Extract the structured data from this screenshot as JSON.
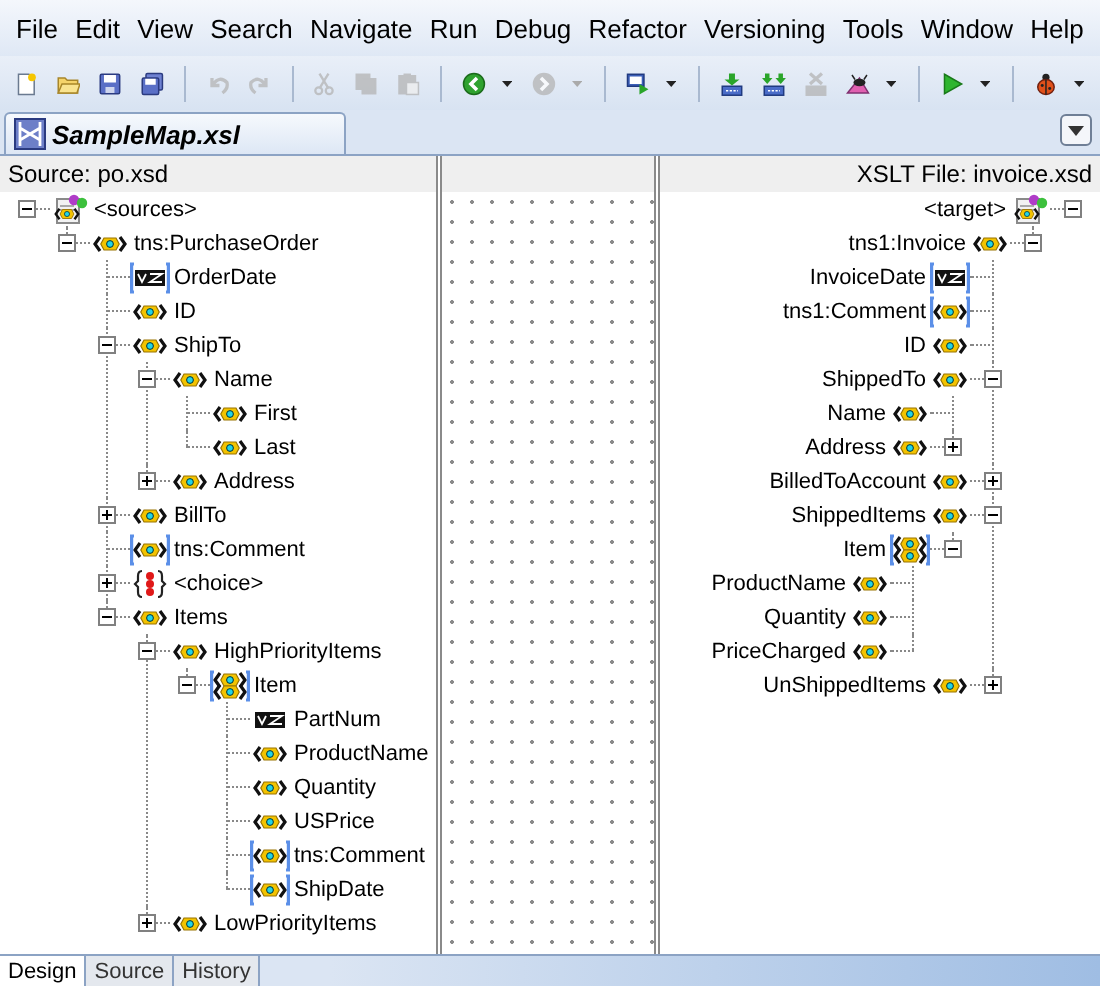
{
  "menu": [
    "File",
    "Edit",
    "View",
    "Search",
    "Navigate",
    "Run",
    "Debug",
    "Refactor",
    "Versioning",
    "Tools",
    "Window",
    "Help"
  ],
  "toolbar": [
    {
      "kind": "new",
      "disabled": false,
      "dropdown": false
    },
    {
      "kind": "open",
      "disabled": false,
      "dropdown": false
    },
    {
      "kind": "save",
      "disabled": false,
      "dropdown": false
    },
    {
      "kind": "save-all",
      "disabled": false,
      "dropdown": false
    },
    {
      "kind": "separator"
    },
    {
      "kind": "undo",
      "disabled": true,
      "dropdown": false
    },
    {
      "kind": "redo",
      "disabled": true,
      "dropdown": false
    },
    {
      "kind": "separator"
    },
    {
      "kind": "cut",
      "disabled": true,
      "dropdown": false
    },
    {
      "kind": "copy",
      "disabled": true,
      "dropdown": false
    },
    {
      "kind": "paste",
      "disabled": true,
      "dropdown": false
    },
    {
      "kind": "separator"
    },
    {
      "kind": "back",
      "disabled": false,
      "dropdown": true
    },
    {
      "kind": "forward",
      "disabled": true,
      "dropdown": true
    },
    {
      "kind": "separator"
    },
    {
      "kind": "sql",
      "disabled": false,
      "dropdown": true
    },
    {
      "kind": "separator"
    },
    {
      "kind": "deploy",
      "disabled": false,
      "dropdown": false
    },
    {
      "kind": "deploy-all",
      "disabled": false,
      "dropdown": false
    },
    {
      "kind": "undeploy",
      "disabled": true,
      "dropdown": false
    },
    {
      "kind": "profile",
      "disabled": false,
      "dropdown": true
    },
    {
      "kind": "separator"
    },
    {
      "kind": "run",
      "disabled": false,
      "dropdown": true
    },
    {
      "kind": "separator"
    },
    {
      "kind": "debug",
      "disabled": false,
      "dropdown": true
    }
  ],
  "editor_tab": {
    "title": "SampleMap.xsl"
  },
  "source": {
    "header": "Source: po.xsd",
    "tree": [
      {
        "label": "<sources>",
        "kind": "root",
        "optional": false,
        "expanded": true,
        "children": [
          {
            "label": "tns:PurchaseOrder",
            "kind": "element",
            "optional": false,
            "expanded": true,
            "children": [
              {
                "label": "OrderDate",
                "kind": "attribute",
                "optional": true
              },
              {
                "label": "ID",
                "kind": "element",
                "optional": false
              },
              {
                "label": "ShipTo",
                "kind": "element",
                "optional": false,
                "expanded": true,
                "children": [
                  {
                    "label": "Name",
                    "kind": "element",
                    "optional": false,
                    "expanded": true,
                    "children": [
                      {
                        "label": "First",
                        "kind": "element",
                        "optional": false
                      },
                      {
                        "label": "Last",
                        "kind": "element",
                        "optional": false
                      }
                    ]
                  },
                  {
                    "label": "Address",
                    "kind": "element",
                    "optional": false,
                    "expanded": false
                  }
                ]
              },
              {
                "label": "BillTo",
                "kind": "element",
                "optional": false,
                "expanded": false
              },
              {
                "label": "tns:Comment",
                "kind": "element",
                "optional": true
              },
              {
                "label": "<choice>",
                "kind": "choice",
                "optional": false,
                "expanded": false
              },
              {
                "label": "Items",
                "kind": "element",
                "optional": false,
                "expanded": true,
                "children": [
                  {
                    "label": "HighPriorityItems",
                    "kind": "element",
                    "optional": false,
                    "expanded": true,
                    "children": [
                      {
                        "label": "Item",
                        "kind": "repeating",
                        "optional": true,
                        "expanded": true,
                        "children": [
                          {
                            "label": "PartNum",
                            "kind": "attribute",
                            "optional": false
                          },
                          {
                            "label": "ProductName",
                            "kind": "element",
                            "optional": false
                          },
                          {
                            "label": "Quantity",
                            "kind": "element",
                            "optional": false
                          },
                          {
                            "label": "USPrice",
                            "kind": "element",
                            "optional": false
                          },
                          {
                            "label": "tns:Comment",
                            "kind": "element",
                            "optional": true
                          },
                          {
                            "label": "ShipDate",
                            "kind": "element",
                            "optional": true
                          }
                        ]
                      }
                    ]
                  },
                  {
                    "label": "LowPriorityItems",
                    "kind": "element",
                    "optional": false,
                    "expanded": false
                  }
                ]
              }
            ]
          }
        ]
      }
    ]
  },
  "target": {
    "header": "XSLT File: invoice.xsd",
    "tree": [
      {
        "label": "<target>",
        "kind": "root",
        "optional": false,
        "expanded": true,
        "children": [
          {
            "label": "tns1:Invoice",
            "kind": "element",
            "optional": false,
            "expanded": true,
            "children": [
              {
                "label": "InvoiceDate",
                "kind": "attribute",
                "optional": true
              },
              {
                "label": "tns1:Comment",
                "kind": "element",
                "optional": true
              },
              {
                "label": "ID",
                "kind": "element",
                "optional": false
              },
              {
                "label": "ShippedTo",
                "kind": "element",
                "optional": false,
                "expanded": true,
                "children": [
                  {
                    "label": "Name",
                    "kind": "element",
                    "optional": false
                  },
                  {
                    "label": "Address",
                    "kind": "element",
                    "optional": false,
                    "expanded": false
                  }
                ]
              },
              {
                "label": "BilledToAccount",
                "kind": "element",
                "optional": false,
                "expanded": false
              },
              {
                "label": "ShippedItems",
                "kind": "element",
                "optional": false,
                "expanded": true,
                "children": [
                  {
                    "label": "Item",
                    "kind": "repeating",
                    "optional": true,
                    "expanded": true,
                    "children": [
                      {
                        "label": "ProductName",
                        "kind": "element",
                        "optional": false
                      },
                      {
                        "label": "Quantity",
                        "kind": "element",
                        "optional": false
                      },
                      {
                        "label": "PriceCharged",
                        "kind": "element",
                        "optional": false
                      }
                    ]
                  }
                ]
              },
              {
                "label": "UnShippedItems",
                "kind": "element",
                "optional": false,
                "expanded": false
              }
            ]
          }
        ]
      }
    ]
  },
  "bottom_tabs": [
    {
      "label": "Design",
      "selected": true
    },
    {
      "label": "Source",
      "selected": false
    },
    {
      "label": "History",
      "selected": false
    }
  ]
}
